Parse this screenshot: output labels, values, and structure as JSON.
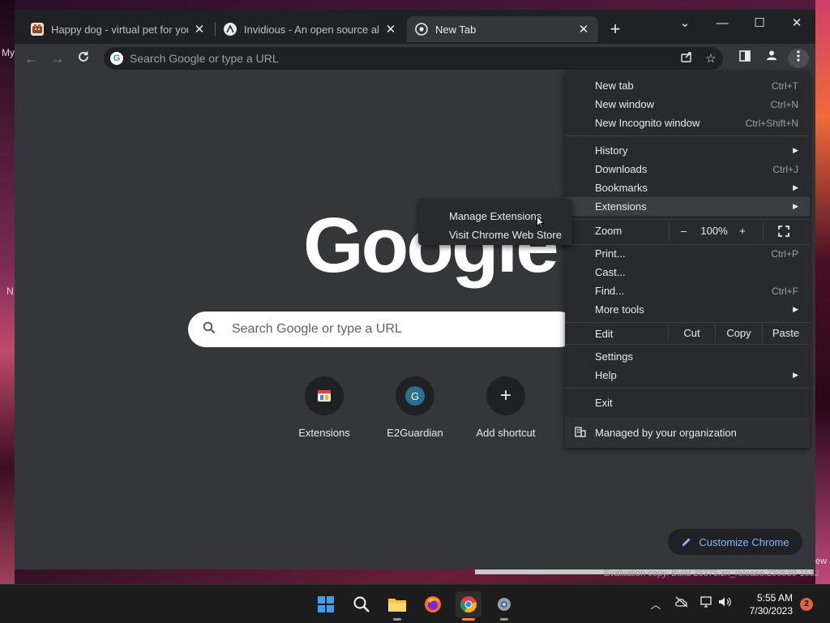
{
  "desktop": {
    "label_top": "My",
    "label_mid": "N",
    "edge_right": "ew"
  },
  "window": {
    "tabs": [
      {
        "title": "Happy dog - virtual pet for you a",
        "active": false
      },
      {
        "title": "Invidious - An open source altern",
        "active": false
      },
      {
        "title": "New Tab",
        "active": true
      }
    ],
    "new_tab_symbol": "+",
    "controls": {
      "tab_search": "⌄",
      "minimize": "—",
      "maximize": "☐",
      "close": "✕"
    }
  },
  "toolbar": {
    "omnibox_placeholder": "Search Google or type a URL"
  },
  "ntp": {
    "logo": "Google",
    "search_placeholder": "Search Google or type a URL",
    "shortcuts": [
      {
        "label": "Extensions",
        "icon": "extensions-favicon"
      },
      {
        "label": "E2Guardian",
        "icon": "letter-g",
        "letter": "G"
      },
      {
        "label": "Add shortcut",
        "icon": "plus-icon",
        "letter": "+"
      }
    ],
    "customize_label": "Customize Chrome"
  },
  "menu": {
    "new_tab": {
      "label": "New tab",
      "shortcut": "Ctrl+T"
    },
    "new_window": {
      "label": "New window",
      "shortcut": "Ctrl+N"
    },
    "incognito": {
      "label": "New Incognito window",
      "shortcut": "Ctrl+Shift+N"
    },
    "history": {
      "label": "History"
    },
    "downloads": {
      "label": "Downloads",
      "shortcut": "Ctrl+J"
    },
    "bookmarks": {
      "label": "Bookmarks"
    },
    "extensions": {
      "label": "Extensions"
    },
    "zoom": {
      "label": "Zoom",
      "minus": "–",
      "value": "100%",
      "plus": "+"
    },
    "print": {
      "label": "Print...",
      "shortcut": "Ctrl+P"
    },
    "cast": {
      "label": "Cast..."
    },
    "find": {
      "label": "Find...",
      "shortcut": "Ctrl+F"
    },
    "more_tools": {
      "label": "More tools"
    },
    "edit": {
      "label": "Edit",
      "cut": "Cut",
      "copy": "Copy",
      "paste": "Paste"
    },
    "settings": {
      "label": "Settings"
    },
    "help": {
      "label": "Help"
    },
    "exit": {
      "label": "Exit"
    },
    "managed": {
      "label": "Managed by your organization"
    }
  },
  "submenu": {
    "manage_extensions": "Manage Extensions",
    "web_store": "Visit Chrome Web Store"
  },
  "watermark": "Evaluation copy. Build 25375.zn_release.230530-1632",
  "taskbar": {
    "time": "5:55 AM",
    "date": "7/30/2023",
    "notification_count": "2"
  },
  "colors": {
    "accent_link": "#8ab4f8",
    "menu_bg": "#292a2d",
    "page_bg": "#35363a",
    "frame_bg": "#202124"
  }
}
